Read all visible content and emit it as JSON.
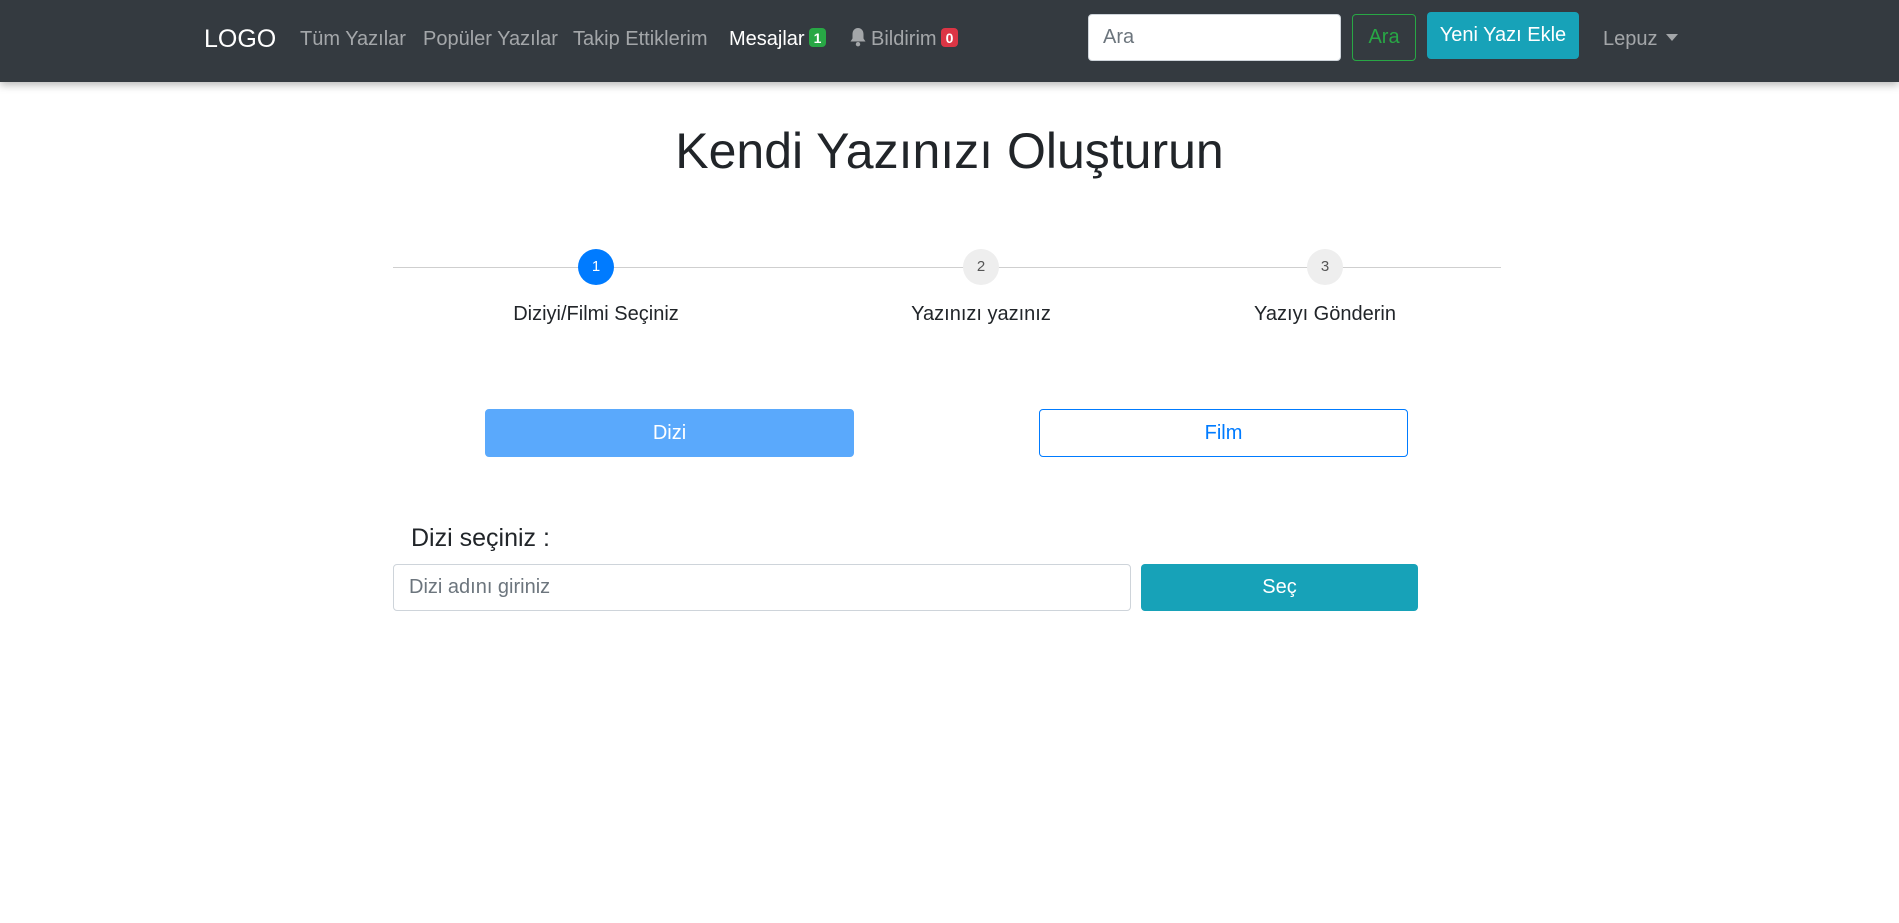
{
  "navbar": {
    "brand": "LOGO",
    "links": [
      "Tüm Yazılar",
      "Popüler Yazılar",
      "Takip Ettiklerim"
    ],
    "messages": {
      "label": "Mesajlar",
      "count": "1"
    },
    "notifications": {
      "label": "Bildirim",
      "count": "0"
    },
    "search": {
      "placeholder": "Ara",
      "value": ""
    },
    "search_button": "Ara",
    "new_post_button": "Yeni Yazı Ekle",
    "user": "Lepuz"
  },
  "page": {
    "title": "Kendi Yazınızı Oluşturun"
  },
  "steps": [
    {
      "number": "1",
      "label": "Diziyi/Filmi Seçiniz",
      "active": true
    },
    {
      "number": "2",
      "label": "Yazınızı yazınız",
      "active": false
    },
    {
      "number": "3",
      "label": "Yazıyı Gönderin",
      "active": false
    }
  ],
  "type_choice": {
    "series": "Dizi",
    "film": "Film",
    "selected": "series"
  },
  "select": {
    "label": "Dizi seçiniz :",
    "placeholder": "Dizi adını giriniz",
    "value": "",
    "button": "Seç"
  },
  "colors": {
    "navbar": "#343a40",
    "primary": "#007bff",
    "selected_button": "#5aa9fc",
    "teal": "#17a2b8",
    "success": "#28a745",
    "danger": "#dc3545"
  },
  "icons": {
    "notification": "bell-icon",
    "user_menu": "caret-down-icon"
  }
}
